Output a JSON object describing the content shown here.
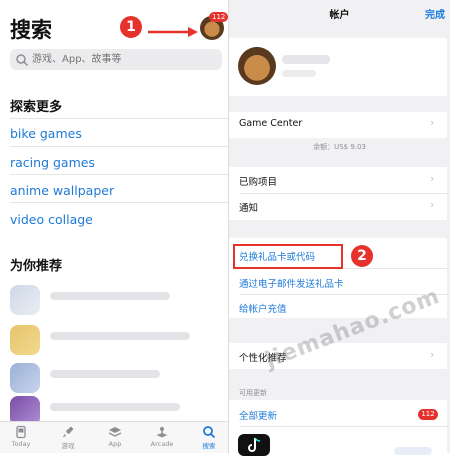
{
  "left_panel": {
    "title": "搜索",
    "avatar_badge": "112",
    "search_placeholder": "游戏、App、故事等",
    "discover_heading": "探索更多",
    "suggestions": [
      "bike games",
      "racing games",
      "anime wallpaper",
      "video collage"
    ],
    "recommend_heading": "为你推荐",
    "tabs": [
      {
        "label": "Today",
        "icon": "today-icon"
      },
      {
        "label": "游戏",
        "icon": "rocket-icon"
      },
      {
        "label": "App",
        "icon": "layers-icon"
      },
      {
        "label": "Arcade",
        "icon": "arcade-icon"
      },
      {
        "label": "搜索",
        "icon": "search-icon"
      }
    ]
  },
  "annotations": {
    "step1": "1",
    "step2": "2"
  },
  "right_panel": {
    "title": "帐户",
    "done": "完成",
    "game_center": "Game Center",
    "balance": "余额：US$ 9.03",
    "purchased": "已购项目",
    "notifications": "通知",
    "redeem": "兑换礼品卡或代码",
    "send_gift": "通过电子邮件发送礼品卡",
    "add_funds": "给帐户充值",
    "personalized": "个性化推荐",
    "updates_label": "可用更新",
    "update_all": "全部更新",
    "update_badge": "112"
  },
  "watermark": "jiemahao.com",
  "colors": {
    "accent": "#1d7bd8",
    "alert": "#e5322d"
  }
}
